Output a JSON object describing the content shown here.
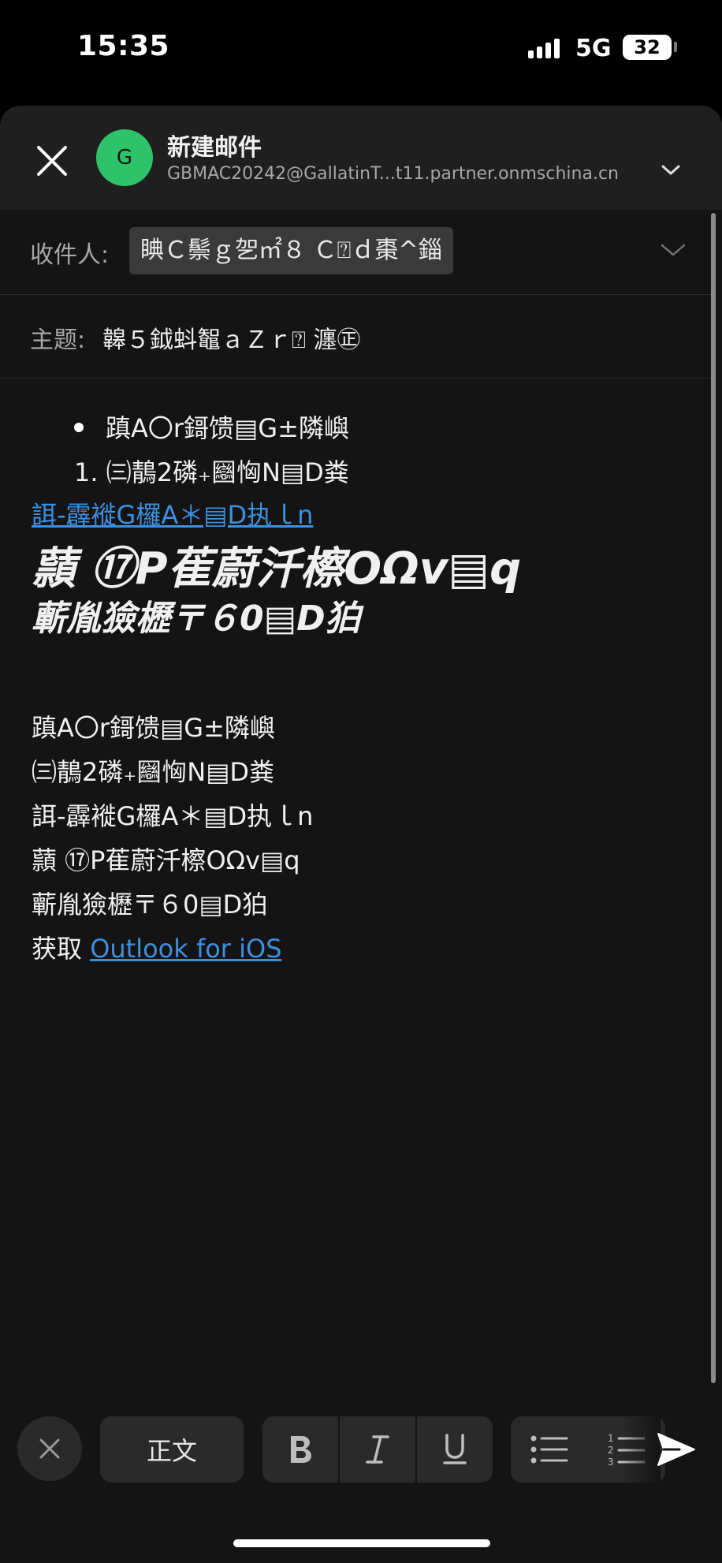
{
  "status_bar": {
    "time": "15:35",
    "network": "5G",
    "battery": "32"
  },
  "header": {
    "title": "新建邮件",
    "avatar_initial": "G",
    "account": "GBMAC20242@GallatinT...t11.partner.onmschina.cn"
  },
  "to": {
    "label": "收件人:",
    "recipient": "睓Ｃ鬃ｇ乫㎡８ Ｃ⍰ｄ棗^錙"
  },
  "subject": {
    "label": "主题:",
    "value": "韟５鉞蚪鼅ａＺｒ⍰ 瀍㊣"
  },
  "body": {
    "bullet_item": "蹎A〇r鎶馈▤G±隣嶼",
    "numbered_marker": "1.",
    "numbered_item": "㈢鶄2磷₊圝恟N▤D粪",
    "link_line": "誀-霹褷G欏A＊▤D执ｌn",
    "heading1": "蘏 ⑰P萑蔚汘檫OΩv▤q",
    "heading2": "蘄胤獫櫪〒６0▤D狛",
    "plain_lines": [
      "蹎A〇r鎶馈▤G±隣嶼",
      "㈢鶄2磷₊圝恟N▤D粪",
      "誀-霹褷G欏A＊▤D执ｌn",
      "蘏 ⑰P萑蔚汘檫OΩv▤q",
      "蘄胤獫櫪〒６0▤D狛"
    ],
    "signature_prefix": "获取 ",
    "signature_link": "Outlook for iOS"
  },
  "toolbar": {
    "style_label": "正文"
  },
  "icons": [
    "close-icon",
    "chevron-down-icon",
    "bold-icon",
    "italic-icon",
    "underline-icon",
    "bullet-list-icon",
    "numbered-list-icon",
    "send-icon"
  ],
  "colors": {
    "accent_link": "#3d8fe0",
    "avatar": "#2ec36a",
    "background": "#141414"
  }
}
